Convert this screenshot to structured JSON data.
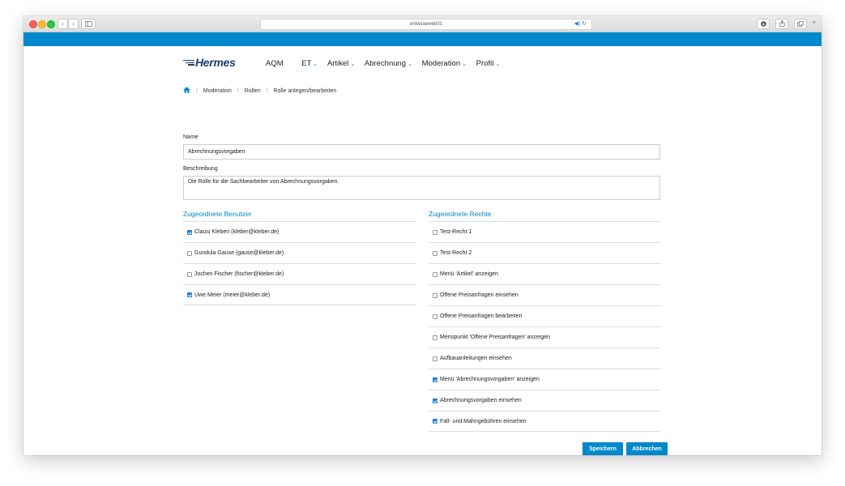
{
  "browser": {
    "url": "entwsaeweb01",
    "back_icon": "chevron-left",
    "forward_icon": "chevron-right",
    "sidebar_icon": "sidebar",
    "reload_icon": "reload",
    "download_icon": "download",
    "share_icon": "share",
    "tabs_icon": "tabs",
    "new_tab_label": "+"
  },
  "header": {
    "logo": "Hermes",
    "nav": [
      {
        "label": "AQM",
        "dropdown": false
      },
      {
        "label": "ET",
        "dropdown": true
      },
      {
        "label": "Artikel",
        "dropdown": true
      },
      {
        "label": "Abrechnung",
        "dropdown": true
      },
      {
        "label": "Moderation",
        "dropdown": true
      },
      {
        "label": "Profil",
        "dropdown": true
      }
    ]
  },
  "breadcrumb": [
    "Moderation",
    "Rollen",
    "Rolle anlegen/bearbeiten"
  ],
  "form": {
    "name_label": "Name",
    "name_value": "Abrechnungsvorgaben",
    "desc_label": "Beschreibung",
    "desc_value": "Die Rolle für die Sachbearbeiter von Abrechnungsvorgaben."
  },
  "users": {
    "title": "Zugeordnete Benutzer",
    "items": [
      {
        "label": "Clausi Kleberi (kleber@kleber.de)",
        "checked": true
      },
      {
        "label": "Gundula Gause (gause@kleber.de)",
        "checked": false
      },
      {
        "label": "Jochen Fischer (fischer@kleber.de)",
        "checked": false
      },
      {
        "label": "Uwe Meier (meier@kleber.de)",
        "checked": true
      }
    ]
  },
  "rights": {
    "title": "Zugeordnete Rechte",
    "items": [
      {
        "label": "Test-Recht 1",
        "checked": false
      },
      {
        "label": "Test-Recht 2",
        "checked": false
      },
      {
        "label": "Menü 'Artikel' anzeigen",
        "checked": false
      },
      {
        "label": "Offene Preisanfragen einsehen",
        "checked": false
      },
      {
        "label": "Offene Preisanfragen bearbeiten",
        "checked": false
      },
      {
        "label": "Menüpunkt 'Offene Preisanfragen' anzeigen",
        "checked": false
      },
      {
        "label": "Aufbauanleitungen einsehen",
        "checked": false
      },
      {
        "label": "Menü 'Abrechnungsvorgaben' anzeigen",
        "checked": true
      },
      {
        "label": "Abrechnungsvorgaben einsehen",
        "checked": true
      },
      {
        "label": "Fall- und Mahngebühren einsehen",
        "checked": true
      }
    ]
  },
  "actions": {
    "save": "Speichern",
    "cancel": "Abbrechen"
  },
  "colors": {
    "brand_blue": "#0088cc",
    "logo_navy": "#1b3d6e",
    "checkbox_blue": "#1e7fd0"
  }
}
